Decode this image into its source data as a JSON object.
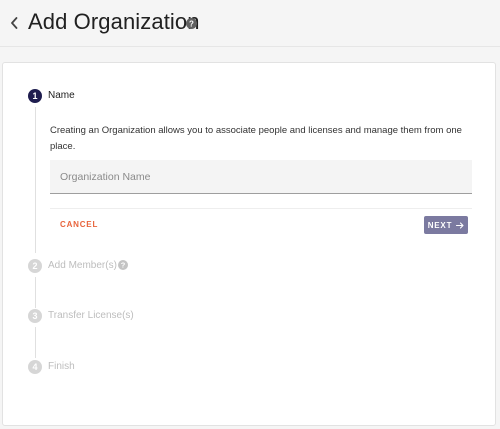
{
  "header": {
    "title": "Add Organization"
  },
  "stepper": {
    "steps": [
      {
        "number": "1",
        "label": "Name"
      },
      {
        "number": "2",
        "label": "Add Member(s)"
      },
      {
        "number": "3",
        "label": "Transfer License(s)"
      },
      {
        "number": "4",
        "label": "Finish"
      }
    ],
    "active_step": 1
  },
  "name_step": {
    "description": "Creating an Organization allows you to associate people and licenses and manage them from one place.",
    "org_name_placeholder": "Organization Name",
    "org_name_value": "",
    "cancel_label": "CANCEL",
    "next_label": "NEXT"
  },
  "colors": {
    "active_step": "#1f1d4f",
    "inactive_step": "#d6d6d6",
    "cancel": "#e8643c",
    "next_button": "#7b7aa0"
  },
  "icons": {
    "back": "chevron-left-icon",
    "help": "help-circle-icon",
    "next_arrow": "arrow-right-icon"
  }
}
